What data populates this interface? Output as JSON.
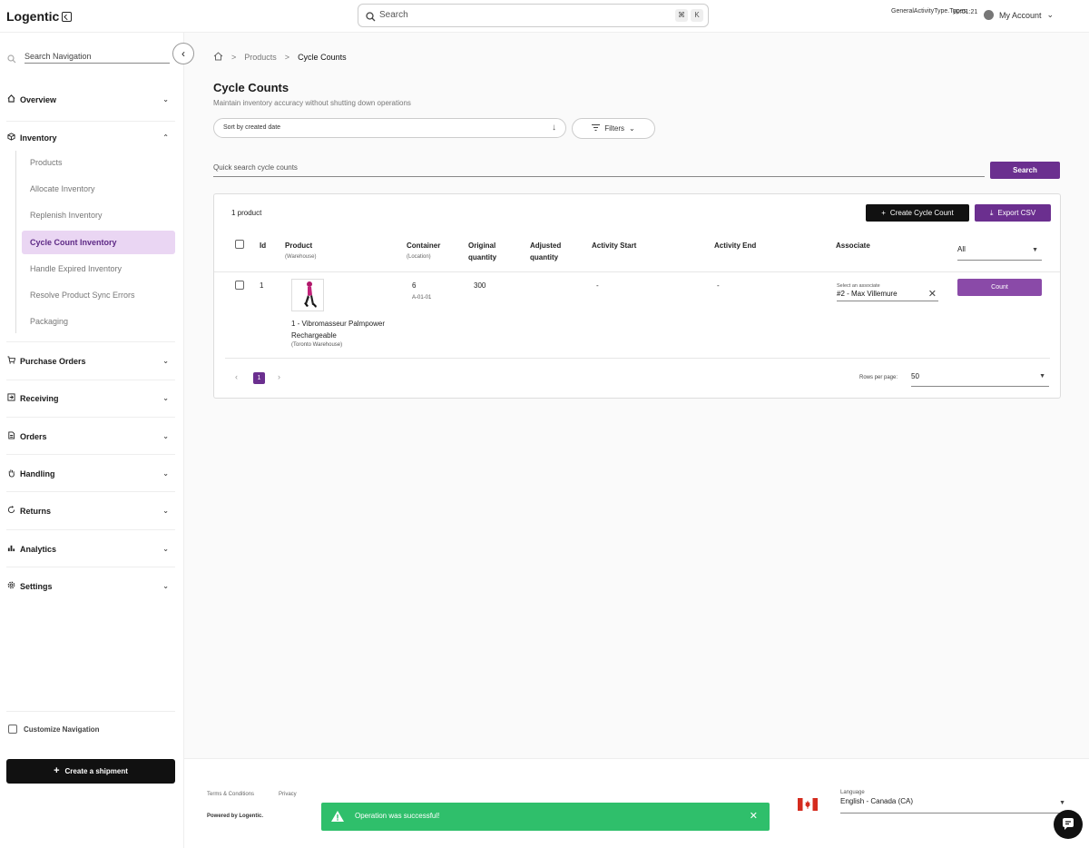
{
  "app": {
    "logo": "Logentic"
  },
  "topbar": {
    "search_placeholder": "Search",
    "kbd_cmd": "⌘",
    "kbd_k": "K",
    "activity_text": "GeneralActivityType.Types.",
    "timer": "00:01:21",
    "account": "My Account"
  },
  "sidebar": {
    "search_placeholder": "Search Navigation",
    "sections": {
      "overview": "Overview",
      "inventory": "Inventory",
      "purchase_orders": "Purchase Orders",
      "receiving": "Receiving",
      "orders": "Orders",
      "handling": "Handling",
      "returns": "Returns",
      "analytics": "Analytics",
      "settings": "Settings"
    },
    "inventory_items": [
      "Products",
      "Allocate Inventory",
      "Replenish Inventory",
      "Cycle Count Inventory",
      "Handle Expired Inventory",
      "Resolve Product Sync Errors",
      "Packaging"
    ],
    "active_item": "Cycle Count Inventory",
    "customize": "Customize Navigation",
    "create_shipment": "Create a shipment"
  },
  "breadcrumb": {
    "sep": ">",
    "products": "Products",
    "current": "Cycle Counts"
  },
  "page": {
    "title": "Cycle Counts",
    "subtitle": "Maintain inventory accuracy without shutting down operations",
    "sort": "Sort by created date",
    "filters": "Filters",
    "quick_search_placeholder": "Quick search cycle counts",
    "search_button": "Search"
  },
  "table": {
    "count_label": "1 product",
    "create_button": "Create Cycle Count",
    "export_button": "Export CSV",
    "headers": {
      "id": "Id",
      "product": "Product",
      "product_sub": "(Warehouse)",
      "container": "Container",
      "container_sub": "(Location)",
      "original_qty": "Original quantity",
      "adjusted_qty": "Adjusted quantity",
      "activity_start": "Activity Start",
      "activity_end": "Activity End",
      "associate": "Associate",
      "filter_value": "All"
    },
    "rows": [
      {
        "id": "1",
        "product_name": "1 - Vibromasseur Palmpower Rechargeable",
        "warehouse": "(Toronto Warehouse)",
        "container": "6",
        "location": "A-01-01",
        "original_qty": "300",
        "adjusted_qty": "",
        "activity_start": "-",
        "activity_end": "-",
        "associate_label": "Select an associate",
        "associate": "#2 - Max Villemure",
        "action": "Count"
      }
    ],
    "pagination": {
      "page": "1",
      "rows_per_page_label": "Rows per page:",
      "rows_per_page": "50"
    }
  },
  "footer": {
    "terms": "Terms & Conditions",
    "privacy": "Privacy",
    "powered": "Powered by Logentic.",
    "language_label": "Language",
    "language": "English - Canada (CA)"
  },
  "toast": {
    "message": "Operation was successful!",
    "color": "#2fbf6b"
  },
  "colors": {
    "accent": "#6b2f8f",
    "active_bg": "#ead6f3"
  }
}
